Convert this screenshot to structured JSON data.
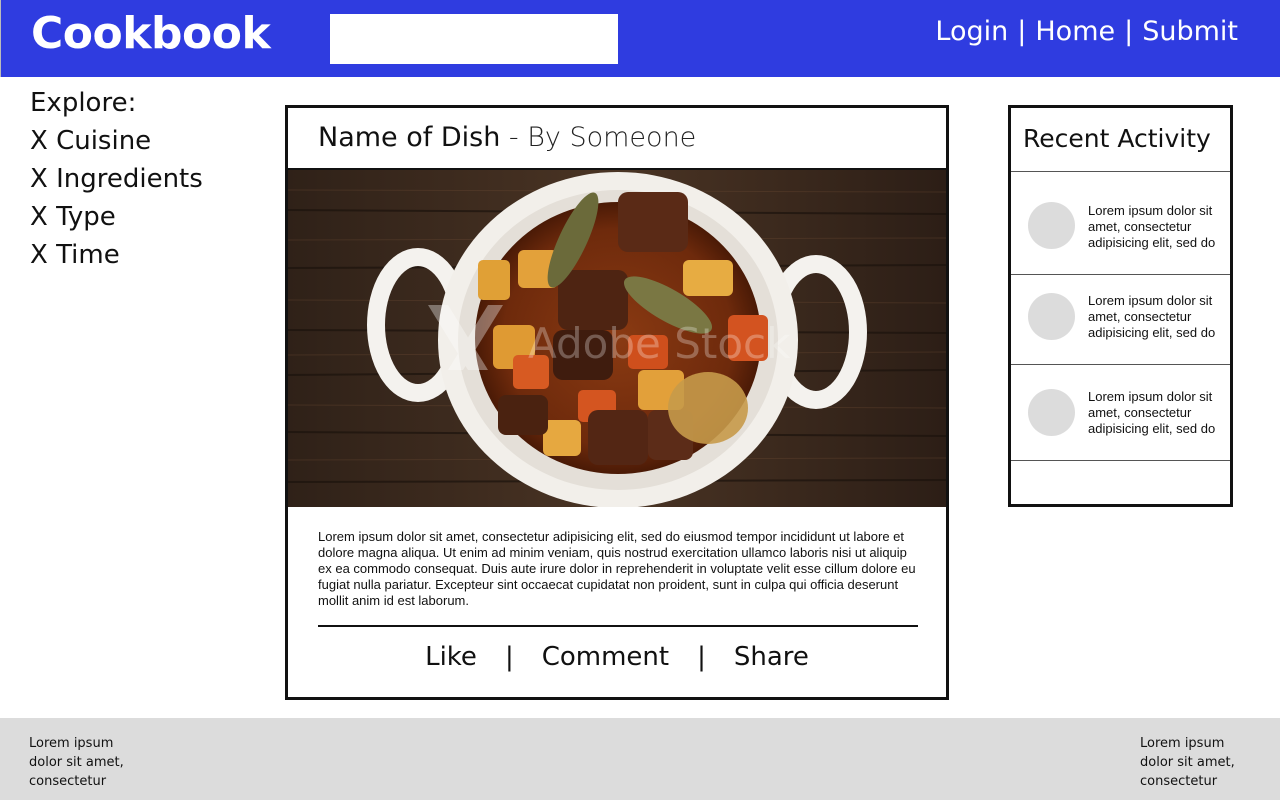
{
  "header": {
    "brand": "Cookbook",
    "search": {
      "value": "",
      "placeholder": ""
    },
    "nav": [
      {
        "label": "Login"
      },
      {
        "label": "Home"
      },
      {
        "label": "Submit"
      }
    ],
    "separator": "|",
    "background_color": "#2f3ce0"
  },
  "explore": {
    "heading": "Explore:",
    "items": [
      {
        "label": "X Cuisine"
      },
      {
        "label": "X Ingredients"
      },
      {
        "label": "X Type"
      },
      {
        "label": "X Time"
      }
    ]
  },
  "post": {
    "title": "Name of Dish",
    "author": " - By Someone",
    "image": {
      "icon": "beef-stew-photo",
      "watermark": "Adobe Stock"
    },
    "body": "Lorem ipsum dolor sit amet, consectetur adipisicing elit, sed do eiusmod tempor incididunt ut labore et dolore magna aliqua. Ut enim ad minim veniam, quis nostrud exercitation ullamco laboris nisi ut aliquip ex ea commodo consequat. Duis aute irure dolor in reprehenderit in voluptate velit esse cillum dolore eu fugiat nulla pariatur. Excepteur sint occaecat cupidatat non proident, sunt in culpa qui officia deserunt mollit anim id est laborum.",
    "actions": [
      {
        "label": "Like"
      },
      {
        "label": "Comment"
      },
      {
        "label": "Share"
      }
    ],
    "action_separator": "|"
  },
  "recent_activity": {
    "title": "Recent Activity",
    "items": [
      {
        "text": "Lorem ipsum dolor sit amet, consectetur adipisicing elit, sed do"
      },
      {
        "text": "Lorem ipsum dolor sit amet, consectetur adipisicing elit, sed do"
      },
      {
        "text": "Lorem ipsum dolor sit amet, consectetur adipisicing elit, sed do"
      }
    ]
  },
  "footer": {
    "left_text": "Lorem ipsum dolor sit amet, consectetur",
    "right_text": "Lorem ipsum dolor sit amet, consectetur",
    "background_color": "#dcdcdc"
  }
}
